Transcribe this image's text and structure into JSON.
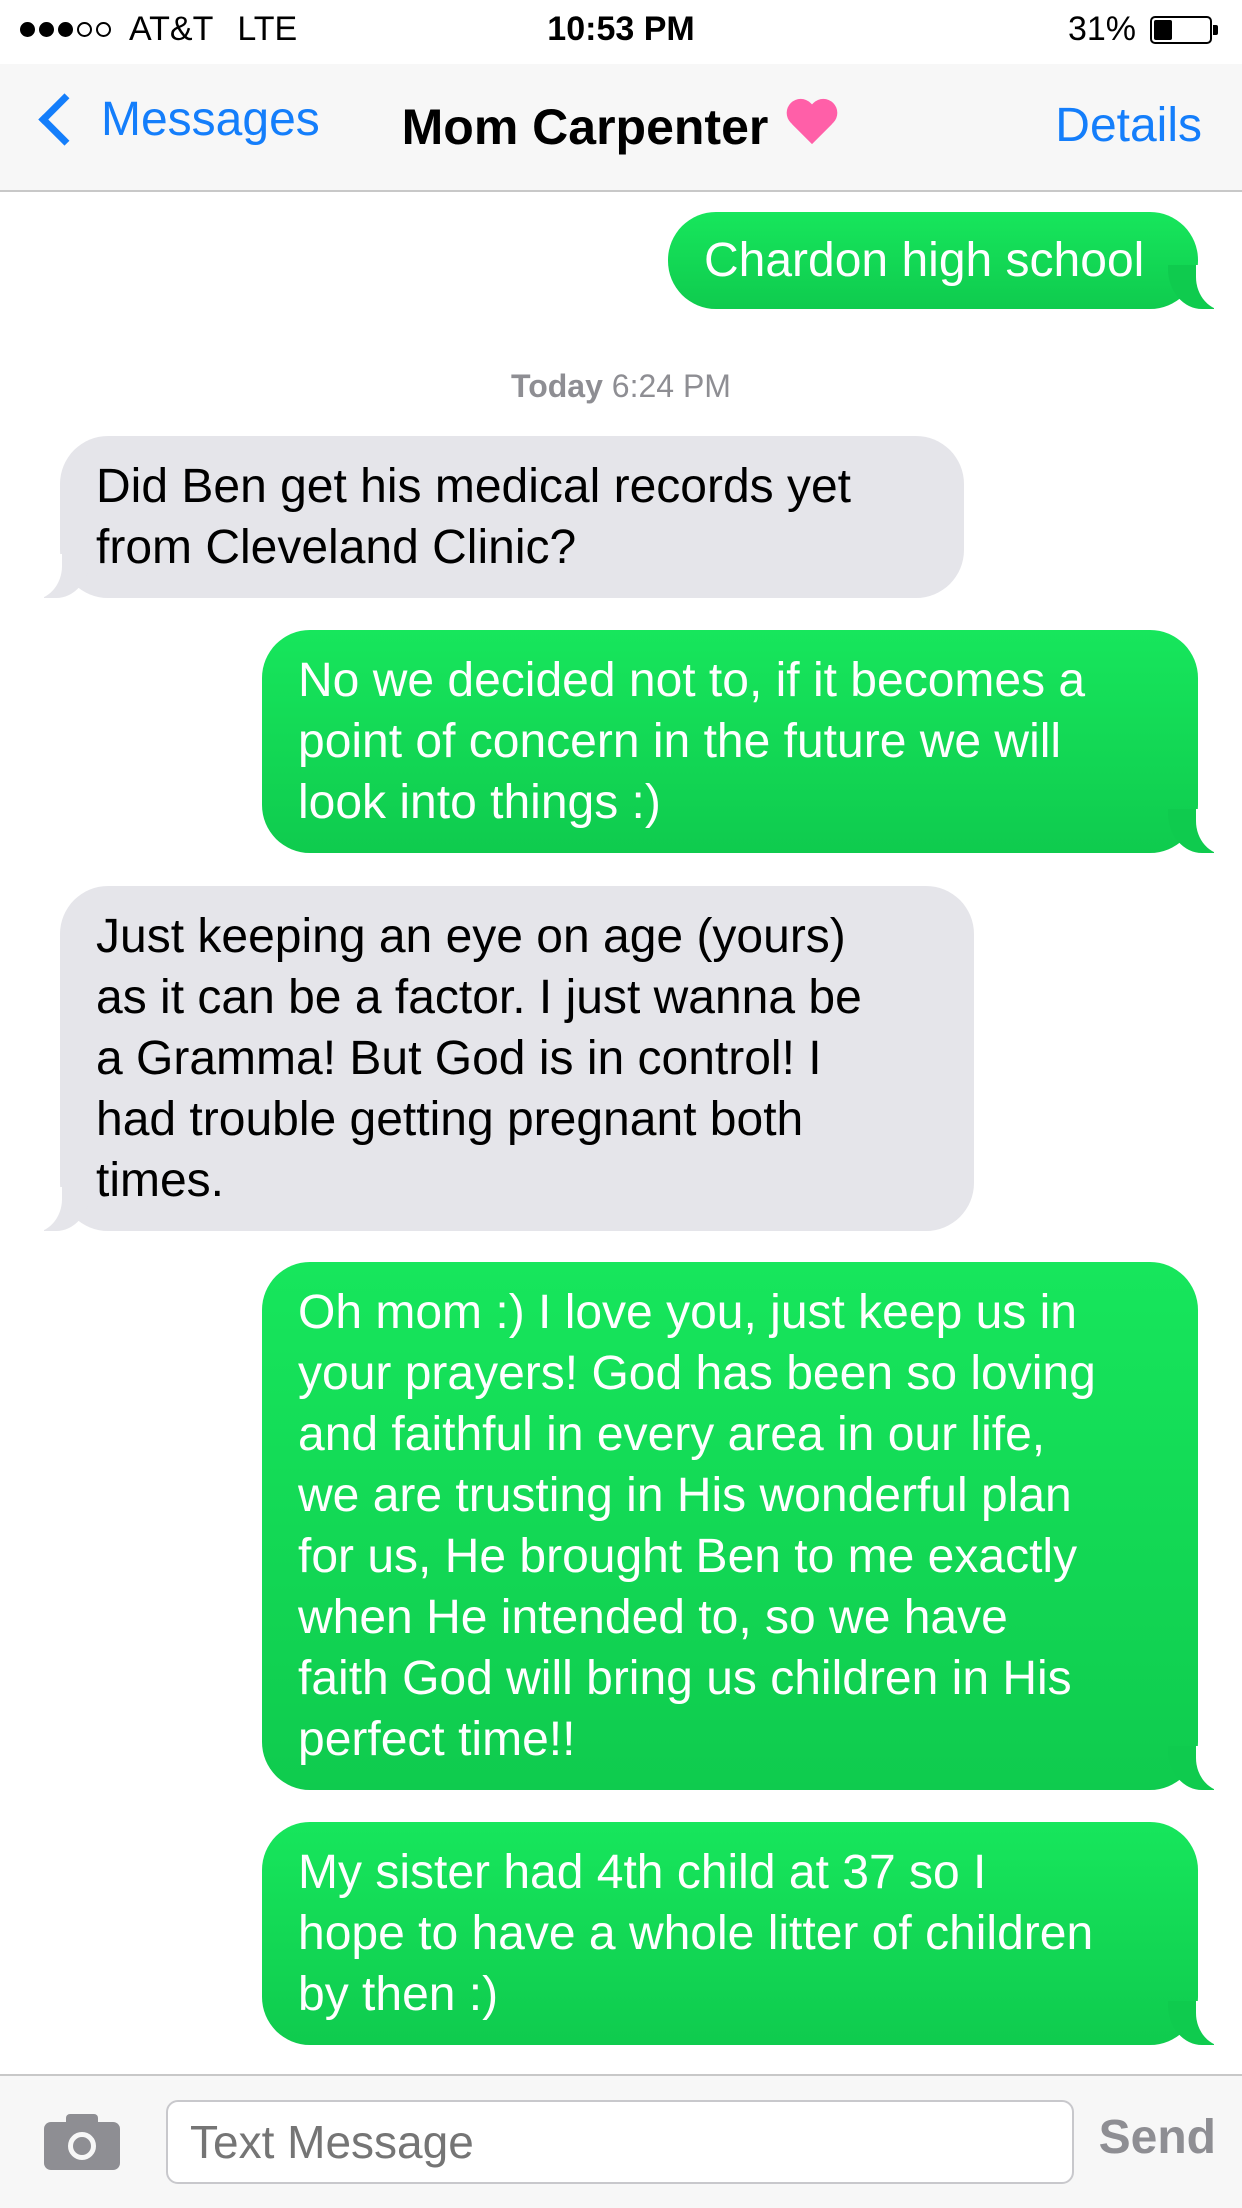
{
  "status": {
    "signal_filled": 3,
    "signal_total": 5,
    "carrier": "AT&T",
    "network": "LTE",
    "time": "10:53 PM",
    "battery": "31%",
    "battery_level": 0.31
  },
  "nav": {
    "back_label": "Messages",
    "title": "Mom Carpenter",
    "title_emoji": "pink-heart-icon",
    "details_label": "Details"
  },
  "thread": {
    "timestamp_day": "Today",
    "timestamp_time": "6:24 PM",
    "messages": [
      {
        "direction": "outgoing",
        "text": "Chardon high school"
      },
      {
        "direction": "incoming",
        "text": "Did Ben get his medical records yet\nfrom Cleveland Clinic?"
      },
      {
        "direction": "outgoing",
        "text": "No we decided not to, if it becomes a\npoint of concern in the future we will\nlook into things :)"
      },
      {
        "direction": "incoming",
        "text": "Just keeping an eye on age (yours)\nas it can be a factor. I just wanna be\na Gramma! But God is in control! I\nhad trouble getting pregnant both\ntimes."
      },
      {
        "direction": "outgoing",
        "text": "Oh mom :) I love you, just keep us in\nyour prayers! God has been so loving\nand faithful in every area in our life,\nwe are trusting in His wonderful plan\nfor us, He brought Ben to me exactly\nwhen He intended to, so we have\nfaith God will bring us children in His\nperfect time!!"
      },
      {
        "direction": "outgoing",
        "text": "My sister had 4th child at 37 so I\nhope to have a whole litter of children\nby then :)"
      }
    ]
  },
  "input": {
    "camera_icon": "camera-icon",
    "placeholder": "Text Message",
    "send_label": "Send"
  },
  "colors": {
    "accent": "#147efb",
    "outgoing_bubble": "#17e65c",
    "incoming_bubble": "#e5e5ea"
  }
}
